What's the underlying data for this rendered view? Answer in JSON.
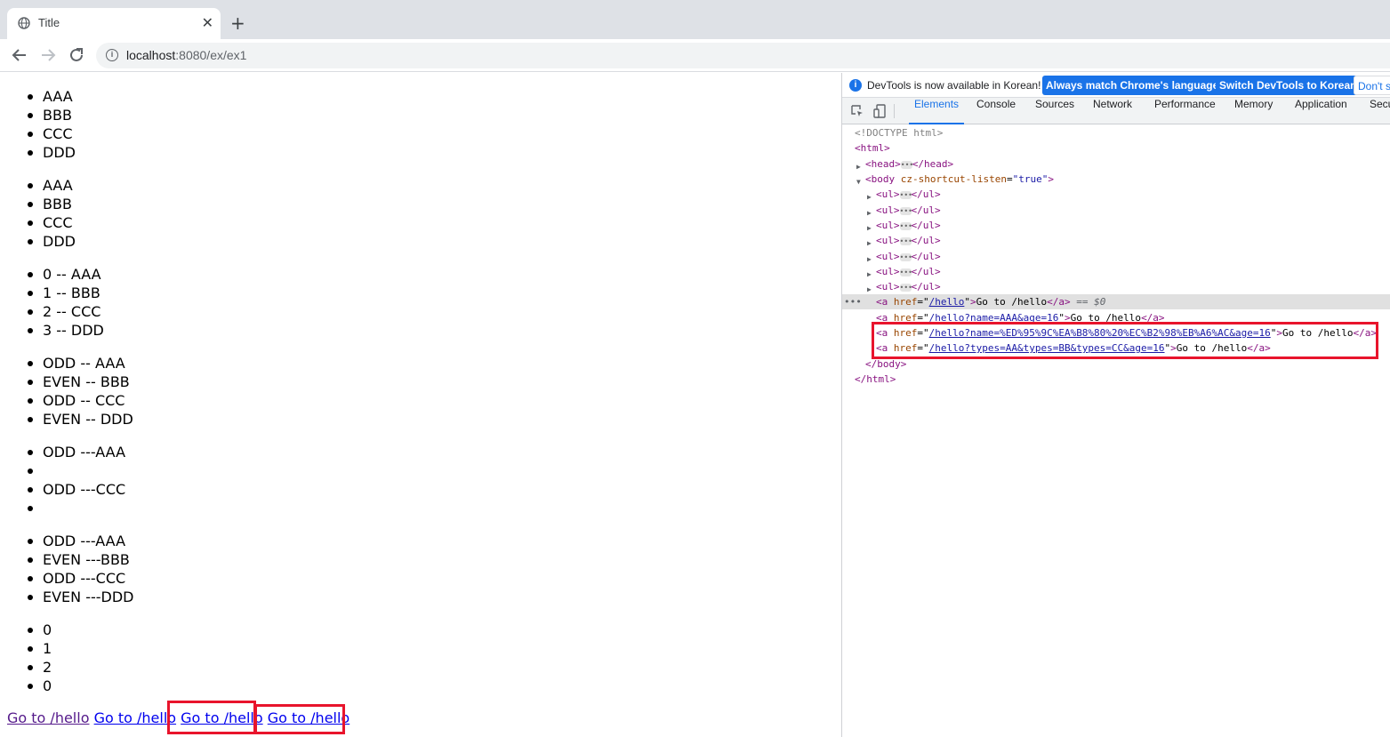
{
  "browser": {
    "tab_title": "Title",
    "tab_close": "✕",
    "new_tab": "+",
    "url_host": "localhost",
    "url_path": ":8080/ex/ex1"
  },
  "page": {
    "lists": [
      [
        "AAA",
        "BBB",
        "CCC",
        "DDD"
      ],
      [
        "AAA",
        "BBB",
        "CCC",
        "DDD"
      ],
      [
        "0 -- AAA",
        "1 -- BBB",
        "2 -- CCC",
        "3 -- DDD"
      ],
      [
        "ODD -- AAA",
        "EVEN -- BBB",
        "ODD -- CCC",
        "EVEN -- DDD"
      ],
      [
        "ODD ---AAA",
        "",
        "ODD ---CCC",
        ""
      ],
      [
        "ODD ---AAA",
        "EVEN ---BBB",
        "ODD ---CCC",
        "EVEN ---DDD"
      ],
      [
        "0",
        "1",
        "2",
        "0"
      ]
    ],
    "links": [
      "Go to /hello",
      "Go to /hello",
      "Go to /hello",
      "Go to /hello"
    ]
  },
  "devtools": {
    "info_message": "DevTools is now available in Korean!",
    "btn_match": "Always match Chrome's language",
    "btn_switch": "Switch DevTools to Korean",
    "btn_dont": "Don't s",
    "tabs": [
      "Elements",
      "Console",
      "Sources",
      "Network",
      "Performance",
      "Memory",
      "Application",
      "Secu"
    ],
    "code": {
      "doctype": "<!DOCTYPE html>",
      "html_open": "<html>",
      "head": "<head>",
      "head_close": "</head>",
      "body_open": "<body",
      "body_attr": "cz-shortcut-listen",
      "body_val": "\"true\"",
      "ul_open": "<ul>",
      "ul_close": "</ul>",
      "a_open": "<a",
      "href": "href",
      "a_end": ">",
      "a_close": "</a>",
      "link_text": "Go to /hello",
      "href1": "/hello",
      "href2": "/hello?name=AAA&age=16",
      "href3": "/hello?name=%ED%95%9C%EA%B8%80%20%EC%B2%98%EB%A6%AC&age=16",
      "href4": "/hello?types=AA&types=BB&types=CC&age=16",
      "sel_marker": "== $0",
      "body_close": "</body>",
      "html_close": "</html>"
    }
  }
}
